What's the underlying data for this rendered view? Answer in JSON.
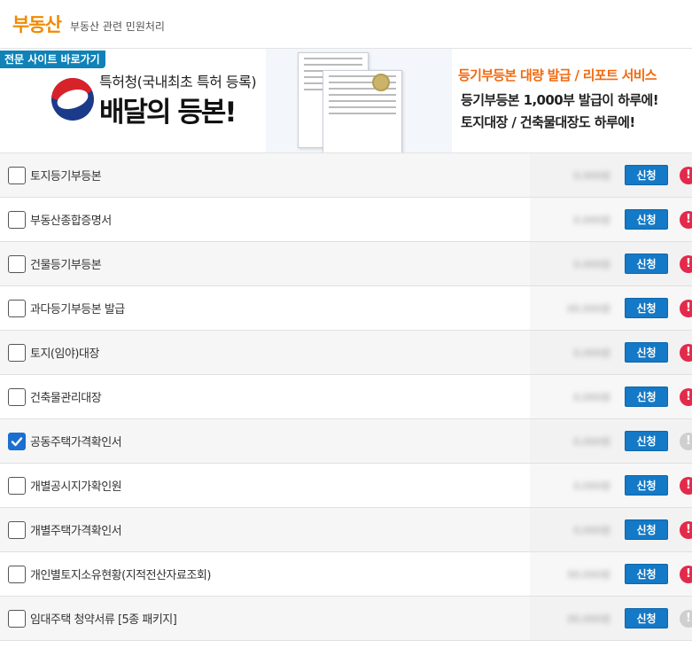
{
  "header": {
    "title": "부동산",
    "subtitle": "부동산 관련 민원처리"
  },
  "banner": {
    "badge": "전문 사이트 바로가기",
    "patent": "특허청(국내최초 특허 등록)",
    "brand": "배달의 등본!",
    "promo_title": "등기부등본 대량 발급 / 리포트 서비스",
    "promo_line1": "등기부등본 1,000부 발급이 하루에!",
    "promo_line2": "토지대장 / 건축물대장도 하루에!"
  },
  "items": [
    {
      "label": "토지등기부등본",
      "checked": false,
      "apply": "신청",
      "alert": "red",
      "price": "0,000원"
    },
    {
      "label": "부동산종합증명서",
      "checked": false,
      "apply": "신청",
      "alert": "red",
      "price": "0,000원"
    },
    {
      "label": "건물등기부등본",
      "checked": false,
      "apply": "신청",
      "alert": "red",
      "price": "0,000원"
    },
    {
      "label": "과다등기부등본 발급",
      "checked": false,
      "apply": "신청",
      "alert": "red",
      "price": "00,000원"
    },
    {
      "label": "토지(임야)대장",
      "checked": false,
      "apply": "신청",
      "alert": "red",
      "price": "0,000원"
    },
    {
      "label": "건축물관리대장",
      "checked": false,
      "apply": "신청",
      "alert": "red",
      "price": "0,000원"
    },
    {
      "label": "공동주택가격확인서",
      "checked": true,
      "apply": "신청",
      "alert": "gray",
      "price": "0,000원"
    },
    {
      "label": "개별공시지가확인원",
      "checked": false,
      "apply": "신청",
      "alert": "red",
      "price": "0,000원"
    },
    {
      "label": "개별주택가격확인서",
      "checked": false,
      "apply": "신청",
      "alert": "red",
      "price": "0,000원"
    },
    {
      "label": "개인별토지소유현황(지적전산자료조회)",
      "checked": false,
      "apply": "신청",
      "alert": "red",
      "price": "00,000원"
    },
    {
      "label": "임대주택 청약서류 [5종 패키지]",
      "checked": false,
      "apply": "신청",
      "alert": "gray",
      "price": "00,000원"
    }
  ],
  "colors": {
    "accent": "#f08a00",
    "button": "#1479c6",
    "alert_red": "#e32a4b",
    "alert_gray": "#cfcfcf",
    "checkbox_checked": "#1a6fd0"
  }
}
